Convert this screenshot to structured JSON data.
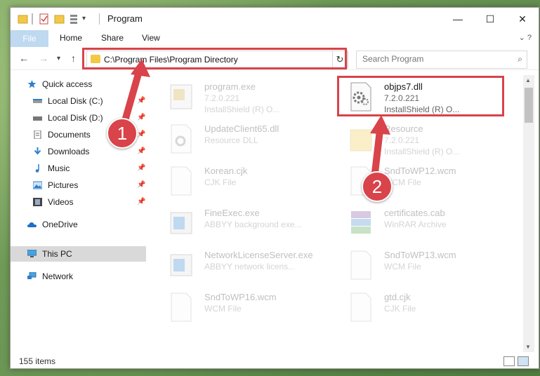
{
  "window": {
    "title": "Program",
    "minimize_glyph": "—",
    "maximize_glyph": "☐",
    "close_glyph": "✕"
  },
  "ribbon": {
    "tabs": [
      "File",
      "Home",
      "Share",
      "View"
    ]
  },
  "address": {
    "path": "C:\\Program Files\\Program Directory",
    "search_placeholder": "Search Program"
  },
  "sidebar": {
    "items": [
      {
        "label": "Quick access",
        "icon": "star-icon"
      },
      {
        "label": "Local Disk (C:)",
        "icon": "drive-icon"
      },
      {
        "label": "Local Disk (D:)",
        "icon": "drive-icon"
      },
      {
        "label": "Documents",
        "icon": "documents-icon"
      },
      {
        "label": "Downloads",
        "icon": "downloads-icon"
      },
      {
        "label": "Music",
        "icon": "music-icon"
      },
      {
        "label": "Pictures",
        "icon": "pictures-icon"
      },
      {
        "label": "Videos",
        "icon": "videos-icon"
      },
      {
        "label": "OneDrive",
        "icon": "cloud-icon"
      },
      {
        "label": "This PC",
        "icon": "pc-icon"
      },
      {
        "label": "Network",
        "icon": "network-icon"
      }
    ]
  },
  "files": [
    {
      "name": "program.exe",
      "line1": "7.2.0.221",
      "line2": "InstallShield (R) O..."
    },
    {
      "name": "objps7.dll",
      "line1": "7.2.0.221",
      "line2": "InstallShield (R) O..."
    },
    {
      "name": "UpdateClient65.dll",
      "line1": "Resource DLL",
      "line2": ""
    },
    {
      "name": "Resource",
      "line1": "7.2.0.221",
      "line2": "InstallShield (R) O..."
    },
    {
      "name": "Korean.cjk",
      "line1": "CJK File",
      "line2": ""
    },
    {
      "name": "SndToWP12.wcm",
      "line1": "WCM File",
      "line2": ""
    },
    {
      "name": "FineExec.exe",
      "line1": "ABBYY background exe...",
      "line2": ""
    },
    {
      "name": "certificates.cab",
      "line1": "WinRAR Archive",
      "line2": ""
    },
    {
      "name": "NetworkLicenseServer.exe",
      "line1": "ABBYY network licens...",
      "line2": ""
    },
    {
      "name": "SndToWP13.wcm",
      "line1": "WCM File",
      "line2": ""
    },
    {
      "name": "SndToWP16.wcm",
      "line1": "WCM File",
      "line2": ""
    },
    {
      "name": "gtd.cjk",
      "line1": "CJK File",
      "line2": ""
    }
  ],
  "status": {
    "item_count": "155 items"
  },
  "callouts": {
    "one": "1",
    "two": "2"
  },
  "colors": {
    "accent": "#1979ca",
    "highlight": "#d9434a"
  }
}
